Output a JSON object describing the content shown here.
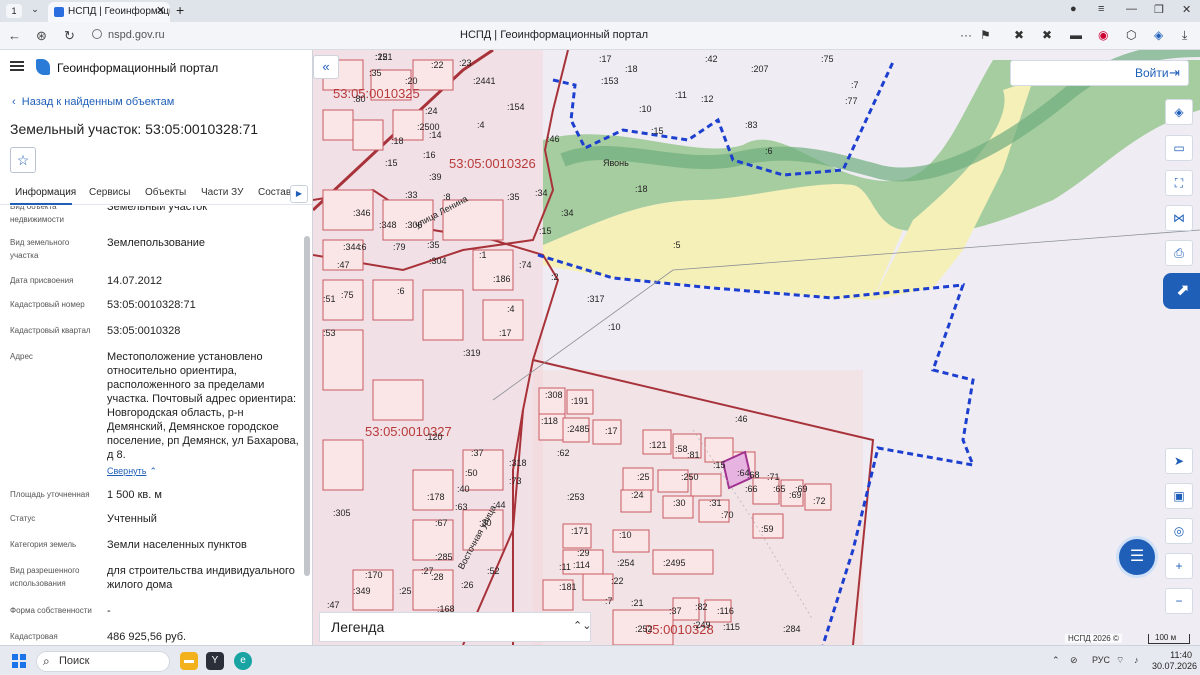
{
  "browser": {
    "tab_number": "1",
    "tab_title": "НСПД | Геоинформацио",
    "url": "nspd.gov.ru",
    "page_title": "НСПД | Геоинформационный портал"
  },
  "panel": {
    "app_title": "Геоинформационный портал",
    "back_label": "Назад к найденным объектам",
    "object_title": "Земельный участок: 53:05:0010328:71",
    "tabs": [
      "Информация",
      "Сервисы",
      "Объекты",
      "Части ЗУ",
      "Состав"
    ],
    "attributes": [
      {
        "key": "Вид объекта недвижимости",
        "value": "Земельный участок"
      },
      {
        "key": "Вид земельного участка",
        "value": "Землепользование"
      },
      {
        "key": "Дата присвоения",
        "value": "14.07.2012"
      },
      {
        "key": "Кадастровый номер",
        "value": "53:05:0010328:71"
      },
      {
        "key": "Кадастровый квартал",
        "value": "53:05:0010328"
      },
      {
        "key": "Адрес",
        "value": "Местоположение установлено относительно ориентира, расположенного за пределами участка. Почтовый адрес ориентира: Новгородская область, р-н Демянский, Демянское городское поселение, рп Демянск, ул Бахарова, д 8."
      },
      {
        "key": "Площадь уточненная",
        "value": "1 500 кв. м"
      },
      {
        "key": "Статус",
        "value": "Учтенный"
      },
      {
        "key": "Категория земель",
        "value": "Земли населенных пунктов"
      },
      {
        "key": "Вид разрешенного использования",
        "value": "для строительства индивидуального жилого дома"
      },
      {
        "key": "Форма собственности",
        "value": "-"
      },
      {
        "key": "Кадастровая",
        "value": "486 925,56 руб."
      }
    ],
    "collapse_label": "Свернуть"
  },
  "map": {
    "login_label": "Войти",
    "legend_label": "Легенда",
    "attribution": "НСПД 2026 ©",
    "scale_label": "100 м",
    "quarters": [
      "53:05:0010325",
      "53:05:0010326",
      "53:05:0010327",
      "05:0010328"
    ],
    "streets": [
      "улица Ленина",
      "Восточная улица",
      "Явонь"
    ],
    "parcel_labels": [
      ":12",
      ":35",
      ":20",
      ":22",
      ":23",
      ":2441",
      ":17",
      ":18",
      ":42",
      ":207",
      ":75",
      ":7",
      ":153",
      ":10",
      ":11",
      ":12",
      ":77",
      ":154",
      ":80",
      ":24",
      ":4",
      ":15",
      ":83",
      ":6",
      ":18",
      ":2500",
      ":16",
      ":14",
      ":34",
      ":15",
      ":39",
      ":18",
      ":46",
      ":8",
      ":33",
      ":35",
      ":34",
      ":346",
      ":348",
      ":306",
      ":15",
      ":6",
      ":35",
      ":344",
      ":79",
      ":304",
      ":1",
      ":74",
      ":5",
      ":47",
      ":6",
      ":186",
      ":2",
      ":75",
      ":317",
      ":51",
      ":4",
      ":10",
      ":53",
      ":17",
      ":319",
      ":308",
      ":191",
      ":46",
      ":118",
      ":2485",
      ":17",
      ":120",
      ":121",
      ":58",
      ":37",
      ":62",
      ":81",
      ":15",
      ":64",
      ":68",
      ":71",
      ":66",
      ":69",
      ":318",
      ":25",
      ":250",
      ":65",
      ":50",
      ":73",
      ":69",
      ":72",
      ":178",
      ":40",
      ":24",
      ":30",
      ":31",
      ":253",
      ":70",
      ":63",
      ":44",
      ":305",
      ":59",
      ":67",
      ":30",
      ":171",
      ":10",
      ":285",
      ":29",
      ":2495",
      ":28",
      ":114",
      ":254",
      ":170",
      ":27",
      ":52",
      ":11",
      ":22",
      ":349",
      ":25",
      ":26",
      ":181",
      ":7",
      ":21",
      ":47",
      ":168",
      ":37",
      ":82",
      ":116",
      ":252",
      ":249",
      ":115",
      ":284",
      ":251"
    ]
  },
  "taskbar": {
    "search_placeholder": "Поиск",
    "lang": "РУС",
    "time": "11:40",
    "date": "30.07.2026"
  }
}
